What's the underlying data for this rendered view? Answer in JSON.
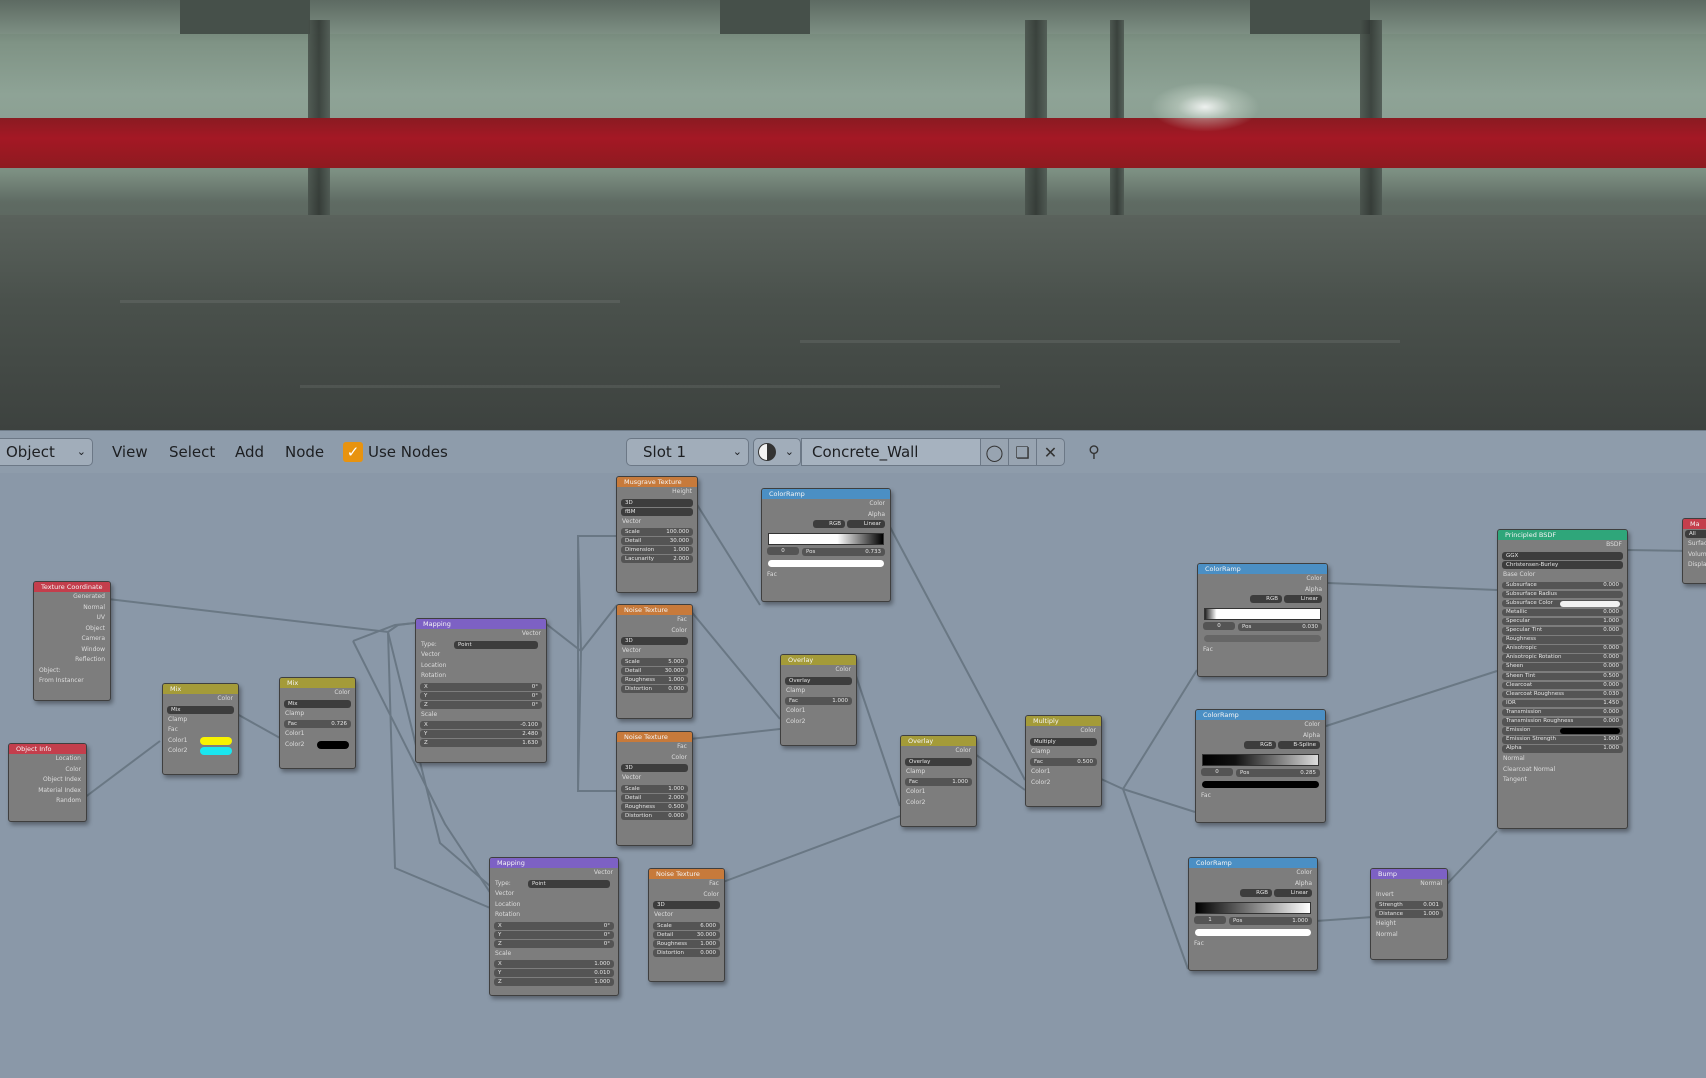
{
  "header": {
    "mode": "Object",
    "menus": [
      "View",
      "Select",
      "Add",
      "Node"
    ],
    "use_nodes_label": "Use Nodes",
    "slot": "Slot 1",
    "material_name": "Concrete_Wall"
  },
  "nodes": {
    "texcoord": {
      "title": "Texture Coordinate",
      "outputs": [
        "Generated",
        "Normal",
        "UV",
        "Object",
        "Camera",
        "Window",
        "Reflection"
      ],
      "object_label": "Object:",
      "from_instancer": "From Instancer"
    },
    "objinfo": {
      "title": "Object Info",
      "outputs": [
        "Location",
        "Color",
        "Object Index",
        "Material Index",
        "Random"
      ]
    },
    "mix1": {
      "title": "Mix",
      "out": "Color",
      "blend": "Mix",
      "clamp": "Clamp",
      "fac": "Fac",
      "c1": "Color1",
      "c2": "Color2"
    },
    "mix2": {
      "title": "Mix",
      "out": "Color",
      "blend": "Mix",
      "clamp": "Clamp",
      "fac": "Fac",
      "fac_val": "0.726",
      "c1": "Color1",
      "c2": "Color2"
    },
    "mapping1": {
      "title": "Mapping",
      "out": "Vector",
      "type_label": "Type:",
      "type": "Point",
      "vector": "Vector",
      "location": "Location",
      "rotation": "Rotation",
      "x": "X",
      "y": "Y",
      "z": "Z",
      "rx": "0°",
      "ry": "0°",
      "rz": "0°",
      "scale": "Scale",
      "sx": "-0.100",
      "sy": "2.480",
      "sz": "1.630"
    },
    "mapping2": {
      "title": "Mapping",
      "out": "Vector",
      "type_label": "Type:",
      "type": "Point",
      "vector": "Vector",
      "location": "Location",
      "rotation": "Rotation",
      "x": "X",
      "y": "Y",
      "z": "Z",
      "rx": "0°",
      "ry": "0°",
      "rz": "0°",
      "scale": "Scale",
      "sx": "1.000",
      "sy": "0.010",
      "sz": "1.000"
    },
    "musgrave": {
      "title": "Musgrave Texture",
      "out": "Height",
      "dim": "3D",
      "kind": "fBM",
      "vector": "Vector",
      "scale": "Scale",
      "scale_v": "100.000",
      "detail": "Detail",
      "detail_v": "30.000",
      "dimension": "Dimension",
      "dimension_v": "1.000",
      "lacunarity": "Lacunarity",
      "lacunarity_v": "2.000"
    },
    "noise1": {
      "title": "Noise Texture",
      "fac": "Fac",
      "color": "Color",
      "dim": "3D",
      "vector": "Vector",
      "scale": "Scale",
      "scale_v": "5.000",
      "detail": "Detail",
      "detail_v": "30.000",
      "rough": "Roughness",
      "rough_v": "1.000",
      "dist": "Distortion",
      "dist_v": "0.000"
    },
    "noise2": {
      "title": "Noise Texture",
      "fac": "Fac",
      "color": "Color",
      "dim": "3D",
      "vector": "Vector",
      "scale": "Scale",
      "scale_v": "1.000",
      "detail": "Detail",
      "detail_v": "2.000",
      "rough": "Roughness",
      "rough_v": "0.500",
      "dist": "Distortion",
      "dist_v": "0.000"
    },
    "noise3": {
      "title": "Noise Texture",
      "fac": "Fac",
      "color": "Color",
      "dim": "3D",
      "vector": "Vector",
      "scale": "Scale",
      "scale_v": "6.000",
      "detail": "Detail",
      "detail_v": "30.000",
      "rough": "Roughness",
      "rough_v": "1.000",
      "dist": "Distortion",
      "dist_v": "0.000"
    },
    "ramp1": {
      "title": "ColorRamp",
      "color": "Color",
      "alpha": "Alpha",
      "mode": "RGB",
      "interp": "Linear",
      "idx": "0",
      "pos": "Pos",
      "pos_v": "0.733",
      "fac": "Fac"
    },
    "overlay1": {
      "title": "Overlay",
      "out": "Color",
      "blend": "Overlay",
      "clamp": "Clamp",
      "fac": "Fac",
      "fac_v": "1.000",
      "c1": "Color1",
      "c2": "Color2"
    },
    "overlay2": {
      "title": "Overlay",
      "out": "Color",
      "blend": "Overlay",
      "clamp": "Clamp",
      "fac": "Fac",
      "fac_v": "1.000",
      "c1": "Color1",
      "c2": "Color2"
    },
    "multiply": {
      "title": "Multiply",
      "out": "Color",
      "blend": "Multiply",
      "clamp": "Clamp",
      "fac": "Fac",
      "fac_v": "0.500",
      "c1": "Color1",
      "c2": "Color2"
    },
    "ramp2": {
      "title": "ColorRamp",
      "color": "Color",
      "alpha": "Alpha",
      "mode": "RGB",
      "interp": "Linear",
      "idx": "0",
      "pos": "Pos",
      "pos_v": "0.030",
      "fac": "Fac"
    },
    "ramp3": {
      "title": "ColorRamp",
      "color": "Color",
      "alpha": "Alpha",
      "mode": "RGB",
      "interp": "B-Spline",
      "idx": "0",
      "pos": "Pos",
      "pos_v": "0.285",
      "fac": "Fac"
    },
    "ramp4": {
      "title": "ColorRamp",
      "color": "Color",
      "alpha": "Alpha",
      "mode": "RGB",
      "interp": "Linear",
      "idx": "1",
      "pos": "Pos",
      "pos_v": "1.000",
      "fac": "Fac"
    },
    "bump": {
      "title": "Bump",
      "out": "Normal",
      "invert": "Invert",
      "strength": "Strength",
      "strength_v": "0.001",
      "distance": "Distance",
      "distance_v": "1.000",
      "height": "Height",
      "normal": "Normal"
    },
    "bsdf": {
      "title": "Principled BSDF",
      "out": "BSDF",
      "dist": "GGX",
      "sss": "Christensen-Burley",
      "rows": [
        {
          "l": "Subsurface",
          "v": "0.000"
        },
        {
          "l": "Subsurface Radius",
          "v": ""
        },
        {
          "l": "Subsurface Color",
          "v": ""
        },
        {
          "l": "Metallic",
          "v": "0.000"
        },
        {
          "l": "Specular",
          "v": "1.000"
        },
        {
          "l": "Specular Tint",
          "v": "0.000"
        },
        {
          "l": "Roughness",
          "v": ""
        },
        {
          "l": "Anisotropic",
          "v": "0.000"
        },
        {
          "l": "Anisotropic Rotation",
          "v": "0.000"
        },
        {
          "l": "Sheen",
          "v": "0.000"
        },
        {
          "l": "Sheen Tint",
          "v": "0.500"
        },
        {
          "l": "Clearcoat",
          "v": "0.000"
        },
        {
          "l": "Clearcoat Roughness",
          "v": "0.030"
        },
        {
          "l": "IOR",
          "v": "1.450"
        },
        {
          "l": "Transmission",
          "v": "0.000"
        },
        {
          "l": "Transmission Roughness",
          "v": "0.000"
        },
        {
          "l": "Emission",
          "v": ""
        },
        {
          "l": "Emission Strength",
          "v": "1.000"
        },
        {
          "l": "Alpha",
          "v": "1.000"
        },
        {
          "l": "Normal",
          "v": ""
        },
        {
          "l": "Clearcoat Normal",
          "v": ""
        },
        {
          "l": "Tangent",
          "v": ""
        }
      ],
      "base_color": "Base Color"
    },
    "output": {
      "title": "Ma",
      "target": "All",
      "surface": "Surface",
      "volume": "Volume",
      "displacement": "Displacement"
    }
  },
  "colors": {
    "mix_color1": "#f7f300",
    "mix_color2": "#19e6f0",
    "mix2_color2": "#000000",
    "accent": "#e8930f"
  }
}
